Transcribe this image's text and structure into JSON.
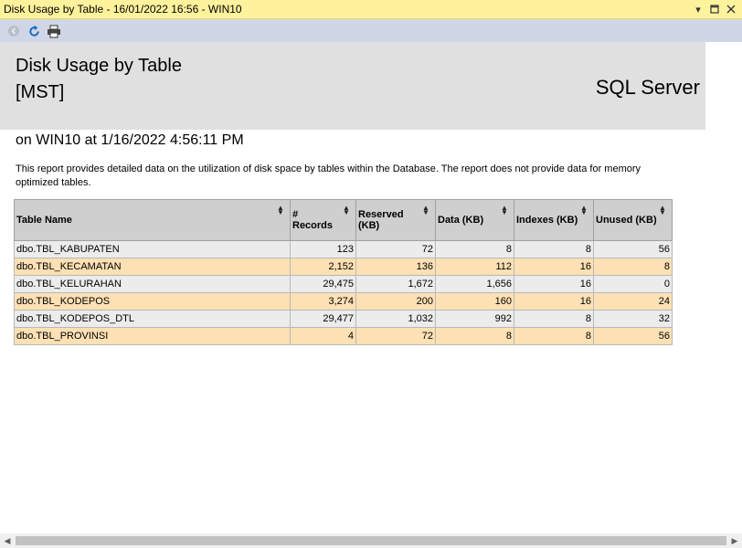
{
  "window": {
    "title": "Disk Usage by Table - 16/01/2022 16:56 - WIN10"
  },
  "toolbar": {
    "buttons": [
      "back-icon",
      "refresh-icon",
      "print-icon"
    ]
  },
  "report": {
    "title": "Disk Usage by Table",
    "database": "[MST]",
    "product": "SQL Server",
    "on_line": "on WIN10 at 1/16/2022 4:56:11 PM",
    "description": "This report provides detailed data on the utilization of disk space by tables within the Database. The report does not provide data for memory optimized tables."
  },
  "table": {
    "headers": [
      "Table Name",
      "# Records",
      "Reserved (KB)",
      "Data (KB)",
      "Indexes (KB)",
      "Unused (KB)"
    ],
    "rows": [
      [
        "dbo.TBL_KABUPATEN",
        "123",
        "72",
        "8",
        "8",
        "56"
      ],
      [
        "dbo.TBL_KECAMATAN",
        "2,152",
        "136",
        "112",
        "16",
        "8"
      ],
      [
        "dbo.TBL_KELURAHAN",
        "29,475",
        "1,672",
        "1,656",
        "16",
        "0"
      ],
      [
        "dbo.TBL_KODEPOS",
        "3,274",
        "200",
        "160",
        "16",
        "24"
      ],
      [
        "dbo.TBL_KODEPOS_DTL",
        "29,477",
        "1,032",
        "992",
        "8",
        "32"
      ],
      [
        "dbo.TBL_PROVINSI",
        "4",
        "72",
        "8",
        "8",
        "56"
      ]
    ]
  },
  "colors": {
    "titlebar": "#fff29d",
    "toolbar": "#cfd6e5",
    "header_band": "#e0e0e0",
    "row_odd": "#ececec",
    "row_even": "#fde0b4",
    "table_header": "#cfcfcf"
  }
}
